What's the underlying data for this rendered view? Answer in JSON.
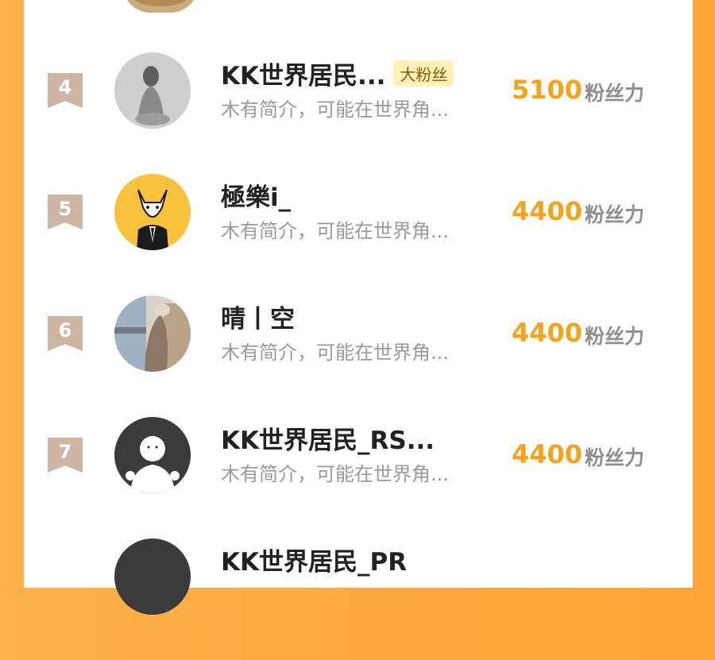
{
  "unit_label": "粉丝力",
  "rows": [
    {
      "rank": "4",
      "name": "KK世界居民...",
      "badge": "大粉丝",
      "bio": "木有简介，可能在世界角...",
      "score": "5100"
    },
    {
      "rank": "5",
      "name": "極樂i_",
      "badge": "",
      "bio": "木有简介，可能在世界角...",
      "score": "4400"
    },
    {
      "rank": "6",
      "name": "晴丨空",
      "badge": "",
      "bio": "木有简介，可能在世界角...",
      "score": "4400"
    },
    {
      "rank": "7",
      "name": "KK世界居民_RS...",
      "badge": "",
      "bio": "木有简介，可能在世界角...",
      "score": "4400"
    },
    {
      "rank": "",
      "name": "KK世界居民_PR",
      "badge": "",
      "bio": "",
      "score": ""
    }
  ],
  "avatar_icons": [
    "gray-photo-avatar-icon",
    "cat-in-suit-avatar-icon",
    "window-photo-avatar-icon",
    "default-person-avatar-icon",
    "default-person-avatar-icon"
  ],
  "colors": {
    "score": "#f5a31a",
    "rank_badge": "#cdb7a4",
    "background": "#ffa436"
  }
}
